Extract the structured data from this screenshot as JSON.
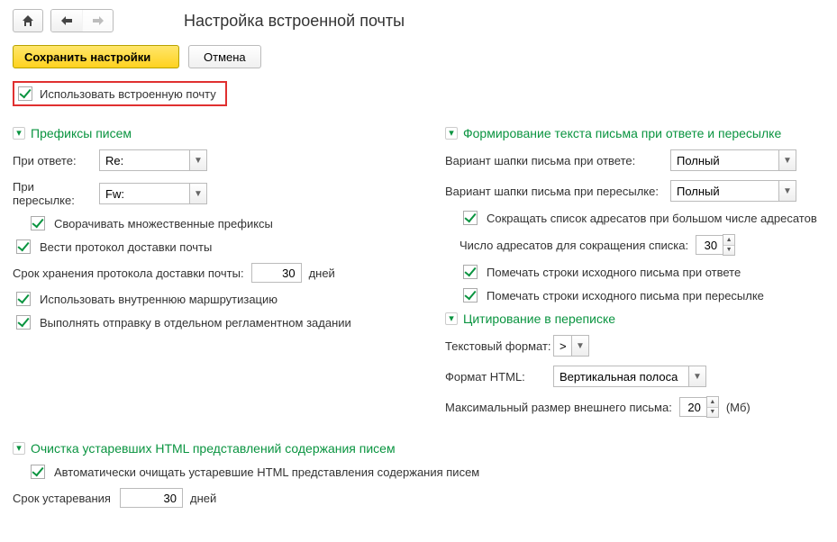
{
  "header": {
    "title": "Настройка встроенной почты"
  },
  "actions": {
    "save": "Сохранить настройки",
    "cancel": "Отмена"
  },
  "use_mail_label": "Использовать встроенную почту",
  "sections": {
    "prefixes": {
      "title": "Префиксы писем",
      "reply_label": "При ответе:",
      "reply_value": "Re:",
      "forward_label": "При пересылке:",
      "forward_value": "Fw:",
      "collapse_label": "Сворачивать множественные префиксы"
    },
    "left_misc": {
      "delivery_log_label": "Вести протокол доставки почты",
      "log_retention_label": "Срок хранения протокола доставки почты:",
      "log_retention_value": "30",
      "log_retention_unit": "дней",
      "internal_routing_label": "Использовать внутреннюю маршрутизацию",
      "separate_job_label": "Выполнять отправку в отдельном регламентном задании"
    },
    "reply_body": {
      "title": "Формирование текста письма при ответе и пересылке",
      "reply_header_label": "Вариант шапки письма при ответе:",
      "reply_header_value": "Полный",
      "forward_header_label": "Вариант шапки письма при пересылке:",
      "forward_header_value": "Полный",
      "shorten_label": "Сокращать список адресатов при большом числе адресатов",
      "count_label": "Число адресатов для сокращения списка:",
      "count_value": "30",
      "mark_reply_label": "Помечать строки исходного письма при ответе",
      "mark_forward_label": "Помечать строки исходного письма при пересылке"
    },
    "quote": {
      "title": "Цитирование в переписке",
      "text_format_label": "Текстовый формат:",
      "text_format_value": ">",
      "html_format_label": "Формат HTML:",
      "html_format_value": "Вертикальная полоса",
      "max_size_label": "Максимальный размер внешнего письма:",
      "max_size_value": "20",
      "max_size_unit": "(Мб)"
    },
    "cleanup": {
      "title": "Очистка устаревших HTML представлений содержания писем",
      "auto_label": "Автоматически очищать устаревшие HTML представления содержания писем",
      "age_label": "Срок устаревания",
      "age_value": "30",
      "age_unit": "дней"
    }
  }
}
